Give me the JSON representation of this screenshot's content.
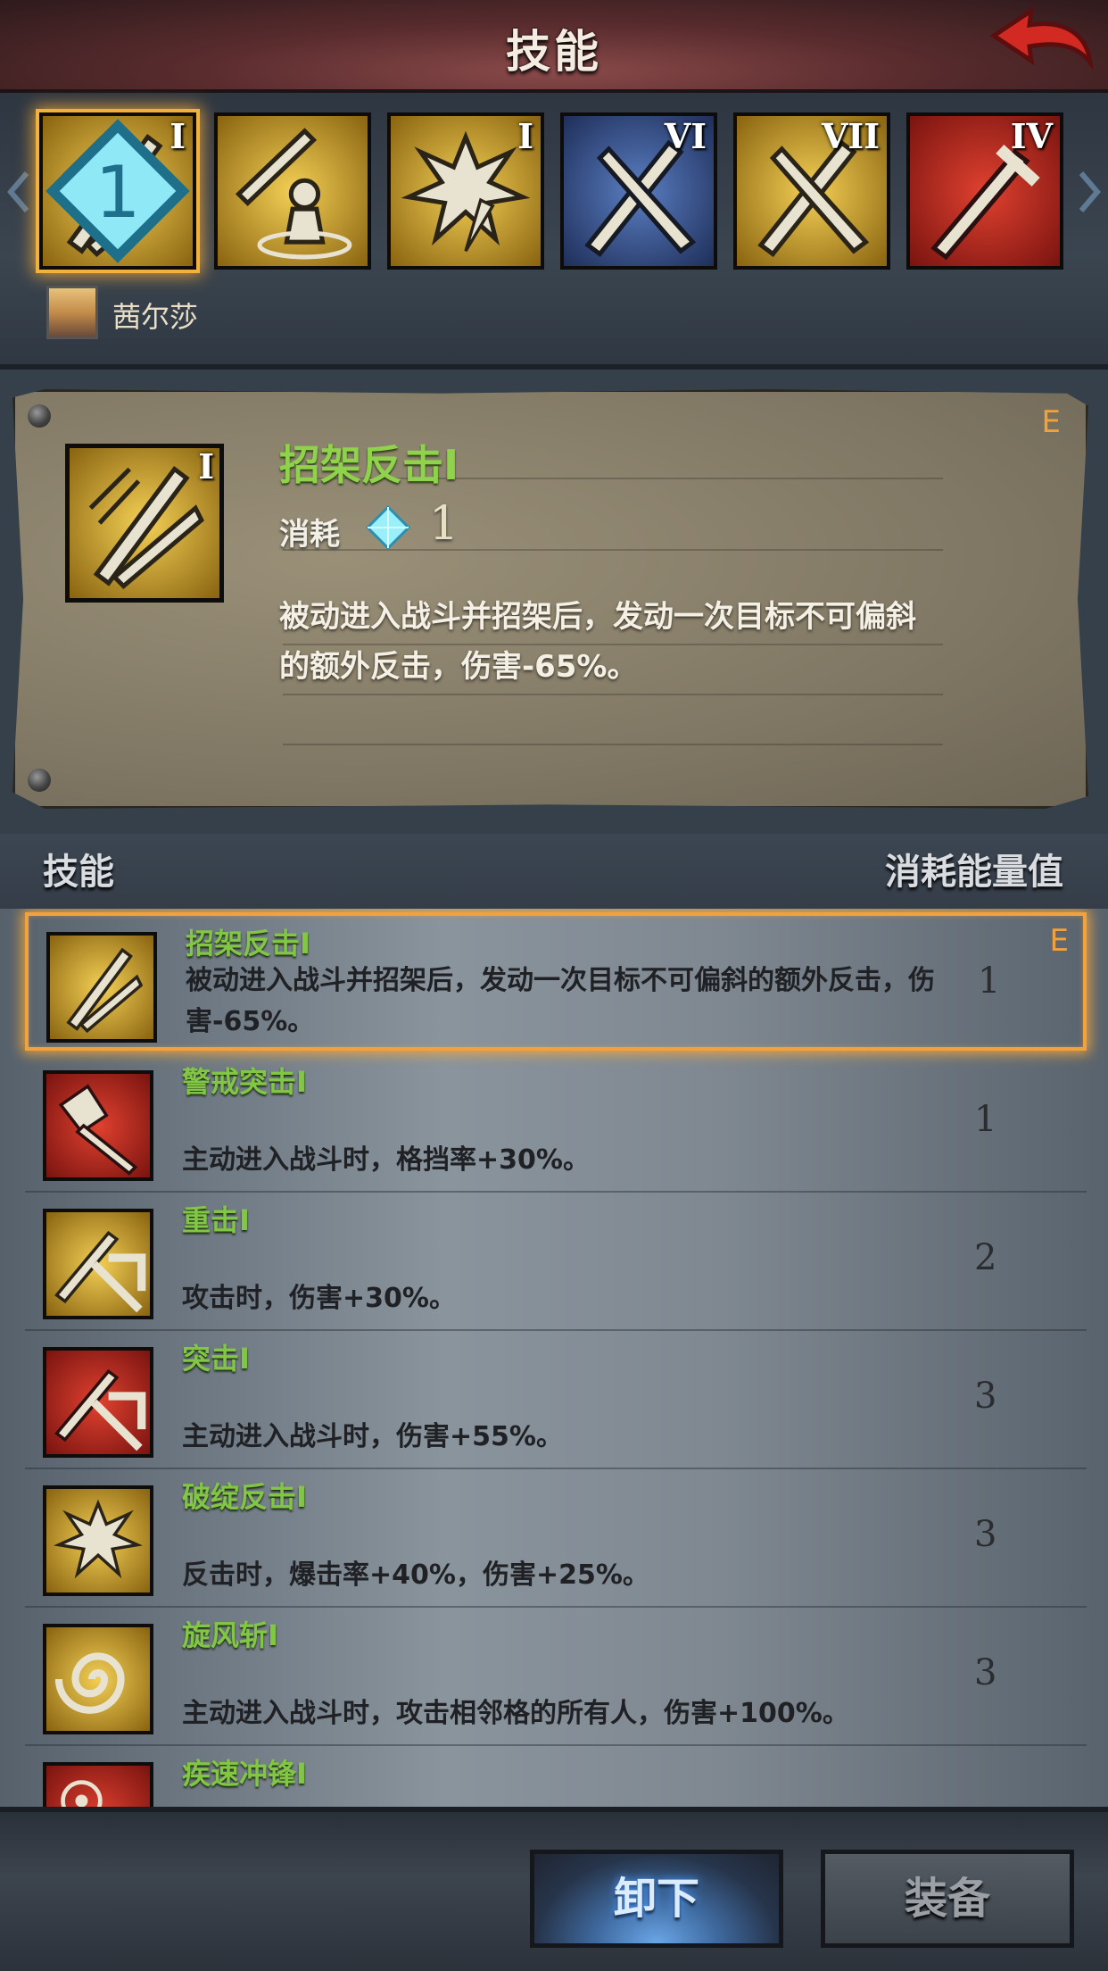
{
  "header": {
    "title": "技能"
  },
  "strip": {
    "slots": [
      {
        "level": "I",
        "cost": "1",
        "icon": "parry-swords-icon",
        "theme": "gold"
      },
      {
        "level": "",
        "icon": "meditation-sword-icon",
        "theme": "gold"
      },
      {
        "level": "I",
        "icon": "burst-swords-icon",
        "theme": "gold"
      },
      {
        "level": "VI",
        "icon": "crossed-swords-icon",
        "theme": "blue"
      },
      {
        "level": "VII",
        "icon": "crossed-swords-icon",
        "theme": "gold"
      },
      {
        "level": "IV",
        "icon": "sword-icon",
        "theme": "red"
      }
    ],
    "hero_name": "茜尔莎"
  },
  "detail": {
    "title": "招架反击I",
    "grade": "E",
    "cost_label": "消耗",
    "cost_value": "1",
    "level": "I",
    "description": "被动进入战斗并招架后，发动一次目标不可偏斜的额外反击，伤害-65%。"
  },
  "list_header": {
    "left": "技能",
    "right": "消耗能量值"
  },
  "skills": [
    {
      "name": "招架反击I",
      "desc": "被动进入战斗并招架后，发动一次目标不可偏斜的额外反击，伤害-65%。",
      "cost": "1",
      "grade": "E",
      "icon": "parry-swords-icon"
    },
    {
      "name": "警戒突击I",
      "desc": "主动进入战斗时，格挡率+30%。",
      "cost": "1",
      "icon": "shield-strike-icon"
    },
    {
      "name": "重击I",
      "desc": "攻击时，伤害+30%。",
      "cost": "2",
      "icon": "heavy-strike-icon"
    },
    {
      "name": "突击I",
      "desc": "主动进入战斗时，伤害+55%。",
      "cost": "3",
      "icon": "assault-icon"
    },
    {
      "name": "破绽反击I",
      "desc": "反击时，爆击率+40%，伤害+25%。",
      "cost": "3",
      "icon": "burst-swords-icon"
    },
    {
      "name": "旋风斩I",
      "desc": "主动进入战斗时，攻击相邻格的所有人，伤害+100%。",
      "cost": "3",
      "icon": "whirlwind-icon"
    },
    {
      "name": "疾速冲锋I",
      "desc": "",
      "cost": "",
      "icon": "charge-icon"
    }
  ],
  "footer": {
    "unequip": "卸下",
    "equip": "装备"
  },
  "colors": {
    "accent": "#f2a23a",
    "skill_name": "#82c646",
    "title_green": "#8fd24c"
  }
}
